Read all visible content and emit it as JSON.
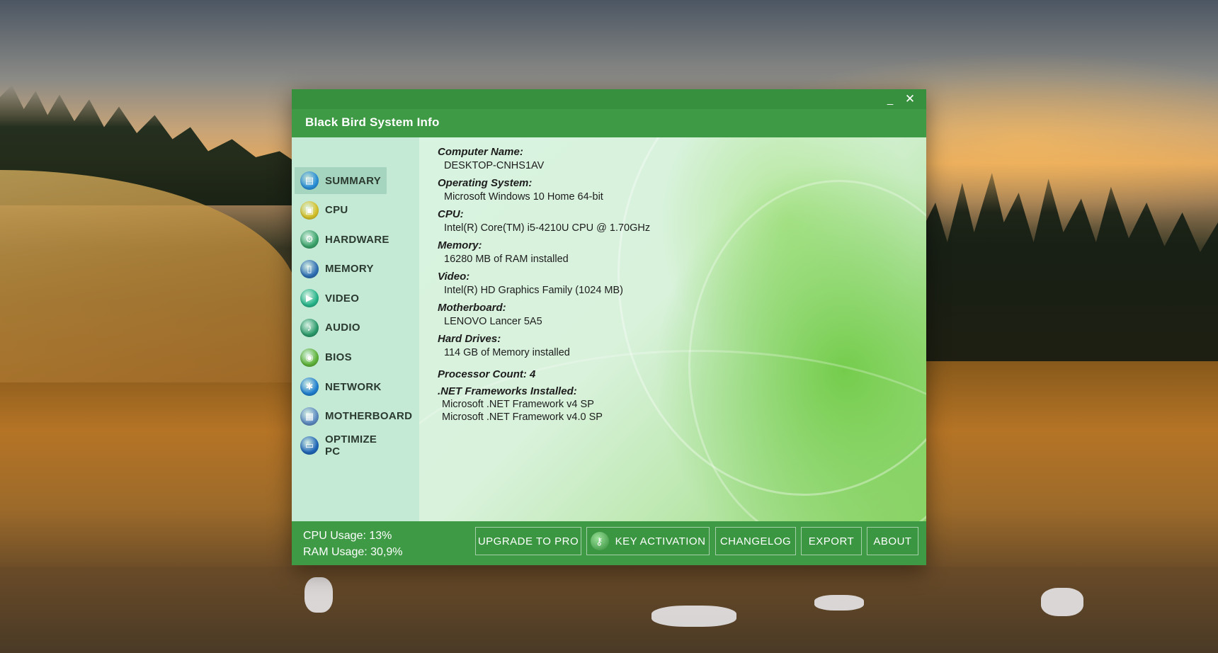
{
  "window": {
    "title": "Black Bird System Info",
    "minimize_glyph": "_",
    "close_glyph": "✕"
  },
  "sidebar": {
    "items": [
      {
        "label": "SUMMARY",
        "icon": "summary-icon",
        "color": "#2a8fd8",
        "glyph": "▤",
        "active": true
      },
      {
        "label": "CPU",
        "icon": "cpu-icon",
        "color": "#d6c22a",
        "glyph": "▣",
        "active": false
      },
      {
        "label": "HARDWARE",
        "icon": "hardware-icon",
        "color": "#3aa36a",
        "glyph": "⚙",
        "active": false
      },
      {
        "label": "MEMORY",
        "icon": "memory-icon",
        "color": "#2f6fb4",
        "glyph": "▯",
        "active": false
      },
      {
        "label": "VIDEO",
        "icon": "video-icon",
        "color": "#27b58a",
        "glyph": "▶",
        "active": false
      },
      {
        "label": "AUDIO",
        "icon": "audio-icon",
        "color": "#2a9a6a",
        "glyph": "♪",
        "active": false
      },
      {
        "label": "BIOS",
        "icon": "bios-icon",
        "color": "#5fb43a",
        "glyph": "◉",
        "active": false
      },
      {
        "label": "NETWORK",
        "icon": "network-icon",
        "color": "#1f7fd0",
        "glyph": "✱",
        "active": false
      },
      {
        "label": "MOTHERBOARD",
        "icon": "motherboard-icon",
        "color": "#5c8ac2",
        "glyph": "▦",
        "active": false
      },
      {
        "label": "OPTIMIZE PC",
        "icon": "optimize-pc-icon",
        "color": "#1f66b8",
        "glyph": "▭",
        "active": false
      }
    ]
  },
  "summary": {
    "computer_name_label": "Computer Name:",
    "computer_name": "DESKTOP-CNHS1AV",
    "os_label": "Operating System:",
    "os": "Microsoft Windows 10 Home 64-bit",
    "cpu_label": "CPU:",
    "cpu": "Intel(R) Core(TM) i5-4210U CPU @ 1.70GHz",
    "memory_label": "Memory:",
    "memory": "16280 MB of RAM installed",
    "video_label": "Video:",
    "video": "Intel(R) HD Graphics Family (1024 MB)",
    "motherboard_label": "Motherboard:",
    "motherboard": "LENOVO Lancer 5A5",
    "hard_drives_label": "Hard Drives:",
    "hard_drives": "114 GB of Memory installed",
    "processor_count": "Processor Count: 4",
    "net_label": ".NET Frameworks Installed:",
    "net_frameworks": [
      "Microsoft .NET Framework v4 SP",
      "Microsoft .NET Framework v4.0 SP"
    ]
  },
  "footer": {
    "cpu_usage": "CPU Usage: 13%",
    "ram_usage": "RAM Usage: 30,9%",
    "buttons": {
      "upgrade": "UPGRADE TO PRO",
      "key_activation": "KEY ACTIVATION",
      "changelog": "CHANGELOG",
      "export": "EXPORT",
      "about": "ABOUT"
    }
  },
  "colors": {
    "title_bar": "#3e9a45",
    "sidebar_bg": "#c4ead6",
    "sidebar_active": "#a6d5bf"
  }
}
